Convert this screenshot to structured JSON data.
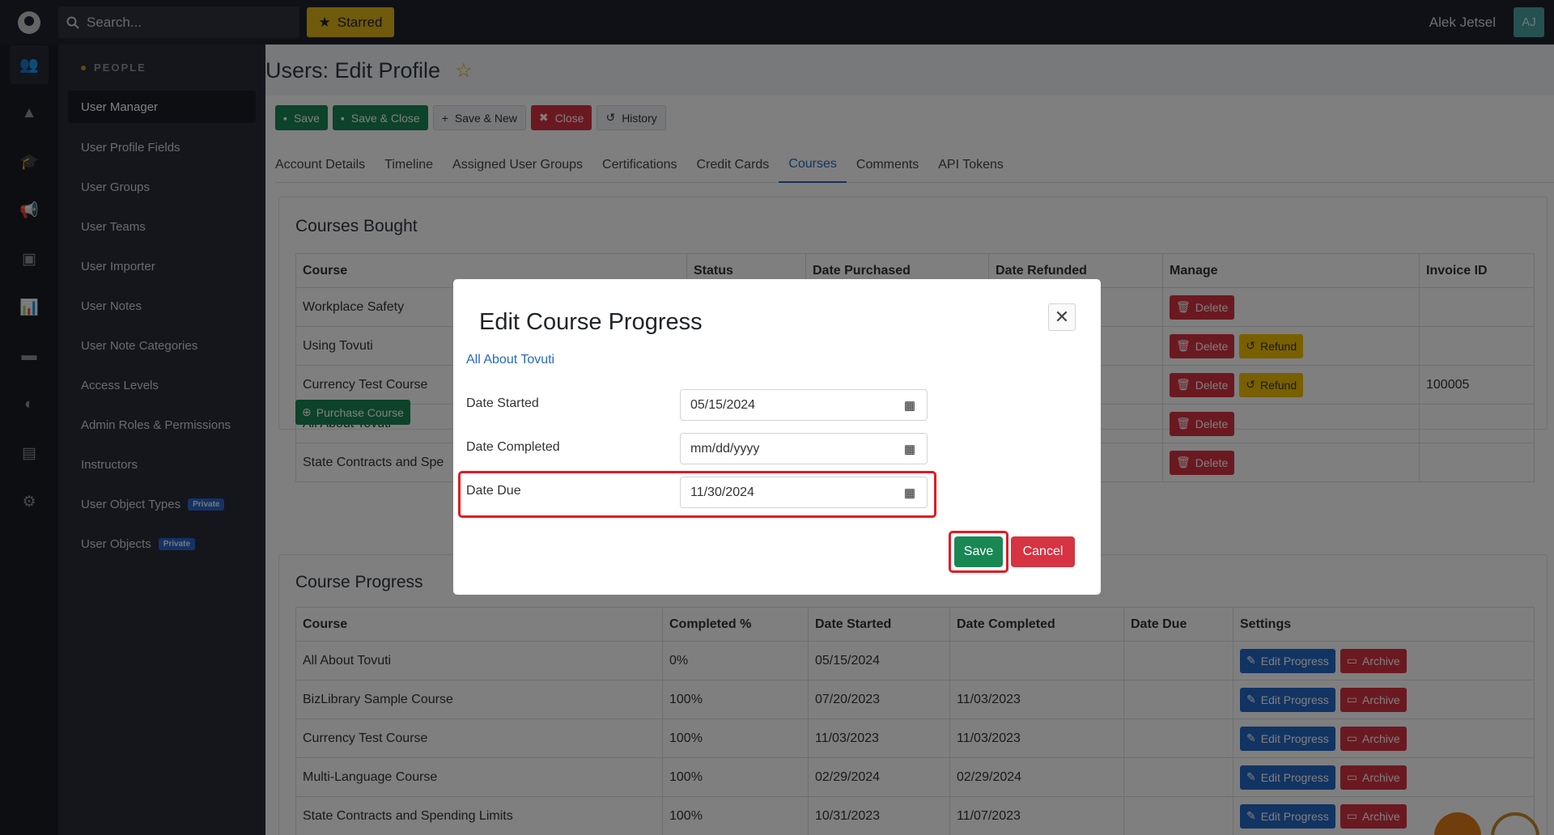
{
  "topbar": {
    "search_placeholder": "Search...",
    "starred_label": "Starred",
    "user_name": "Alek Jetsel",
    "user_initials": "AJ"
  },
  "sidebar": {
    "heading": "PEOPLE",
    "items": [
      {
        "label": "User Manager"
      },
      {
        "label": "User Profile Fields"
      },
      {
        "label": "User Groups"
      },
      {
        "label": "User Teams"
      },
      {
        "label": "User Importer"
      },
      {
        "label": "User Notes"
      },
      {
        "label": "User Note Categories"
      },
      {
        "label": "Access Levels"
      },
      {
        "label": "Admin Roles & Permissions"
      },
      {
        "label": "Instructors"
      },
      {
        "label": "User Object Types",
        "badge": "Private"
      },
      {
        "label": "User Objects",
        "badge": "Private"
      }
    ]
  },
  "page": {
    "title": "Users: Edit Profile",
    "toolbar": {
      "save": "Save",
      "save_close": "Save & Close",
      "save_new": "Save & New",
      "close": "Close",
      "history": "History"
    },
    "tabs": [
      "Account Details",
      "Timeline",
      "Assigned User Groups",
      "Certifications",
      "Credit Cards",
      "Courses",
      "Comments",
      "API Tokens"
    ]
  },
  "courses_bought": {
    "title": "Courses Bought",
    "headers": [
      "Course",
      "Status",
      "Date Purchased",
      "Date Refunded",
      "Manage",
      "Invoice ID"
    ],
    "rows": [
      {
        "course": "Workplace Safety",
        "invoice": ""
      },
      {
        "course": "Using Tovuti",
        "invoice": ""
      },
      {
        "course": "Currency Test Course",
        "invoice": "100005"
      },
      {
        "course": "All About Tovuti",
        "invoice": ""
      },
      {
        "course": "State Contracts and Spe",
        "invoice": ""
      }
    ],
    "delete_label": "Delete",
    "refund_label": "Refund",
    "purchase_label": "Purchase Course"
  },
  "course_progress": {
    "title": "Course Progress",
    "headers": [
      "Course",
      "Completed %",
      "Date Started",
      "Date Completed",
      "Date Due",
      "Settings"
    ],
    "rows": [
      {
        "course": "All About Tovuti",
        "pct": "0%",
        "started": "05/15/2024",
        "completed": "",
        "due": ""
      },
      {
        "course": "BizLibrary Sample Course",
        "pct": "100%",
        "started": "07/20/2023",
        "completed": "11/03/2023",
        "due": ""
      },
      {
        "course": "Currency Test Course",
        "pct": "100%",
        "started": "11/03/2023",
        "completed": "11/03/2023",
        "due": ""
      },
      {
        "course": "Multi-Language Course",
        "pct": "100%",
        "started": "02/29/2024",
        "completed": "02/29/2024",
        "due": ""
      },
      {
        "course": "State Contracts and Spending Limits",
        "pct": "100%",
        "started": "10/31/2023",
        "completed": "11/07/2023",
        "due": ""
      }
    ],
    "edit_label": "Edit Progress",
    "archive_label": "Archive"
  },
  "modal": {
    "title": "Edit Course Progress",
    "course_link": "All About Tovuti",
    "fields": {
      "date_started": {
        "label": "Date Started",
        "value": "05/15/2024"
      },
      "date_completed": {
        "label": "Date Completed",
        "value": "mm/dd/yyyy"
      },
      "date_due": {
        "label": "Date Due",
        "value": "11/30/2024"
      }
    },
    "save_label": "Save",
    "cancel_label": "Cancel",
    "highlight_color": "#e01b24"
  },
  "colors": {
    "green": "#198754",
    "red": "#d63343",
    "blue": "#2569c6",
    "yellow": "#e0b416"
  }
}
